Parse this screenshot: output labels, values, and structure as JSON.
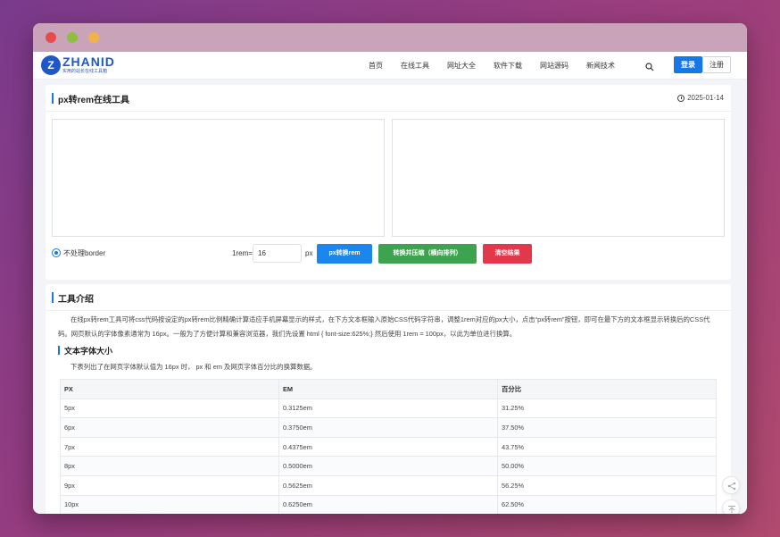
{
  "nav": {
    "logo_mark": "Z",
    "logo_text": "ZHANID",
    "logo_sub": "实用的站长在线工具箱",
    "links": [
      "首页",
      "在线工具",
      "网址大全",
      "软件下载",
      "网站源码",
      "新闻技术"
    ],
    "login": "登录",
    "register": "注册"
  },
  "tool": {
    "title": "px转rem在线工具",
    "date": "2025-01-14",
    "input_placeholder": "",
    "output_placeholder": "",
    "option_label": "不处理border",
    "rem_label": "1rem=",
    "rem_value": "16",
    "px_label": "px",
    "btn_convert": "px转换rem",
    "btn_compress": "转换并压缩（横向排列）",
    "btn_clear": "清空结果"
  },
  "intro": {
    "title": "工具介绍",
    "paragraph": "在线px转rem工具可将css代码按设定的px转rem比例精确计算适应手机屏幕显示的样式，在下方文本框输入原始CSS代码字符串，调整1rem对应的px大小，点击“px转rem”按钮，即可在最下方的文本框显示转换后的CSS代码。网页默认的字体像素通常为 16px。一般为了方便计算和兼容浏览器，我们先设置 html { font-size:625%;} 然后使用 1rem = 100px，以此为单位进行换算。",
    "subtitle": "文本字体大小",
    "table_desc": "下表列出了在网页字体默认值为 16px 时， px 和 em 及网页字体百分比的换算数据。",
    "table": {
      "headers": [
        "PX",
        "EM",
        "百分比"
      ],
      "rows": [
        [
          "5px",
          "0.3125em",
          "31.25%"
        ],
        [
          "6px",
          "0.3750em",
          "37.50%"
        ],
        [
          "7px",
          "0.4375em",
          "43.75%"
        ],
        [
          "8px",
          "0.5000em",
          "50.00%"
        ],
        [
          "9px",
          "0.5625em",
          "56.25%"
        ],
        [
          "10px",
          "0.6250em",
          "62.50%"
        ]
      ]
    }
  },
  "colors": {
    "accent": "#1677e5",
    "convert_btn": "#1c86ee",
    "compress_btn": "#3ea34f",
    "clear_btn": "#e2384a"
  },
  "icons": [
    "search-icon",
    "clock-icon",
    "share-icon",
    "back-to-top-icon"
  ]
}
